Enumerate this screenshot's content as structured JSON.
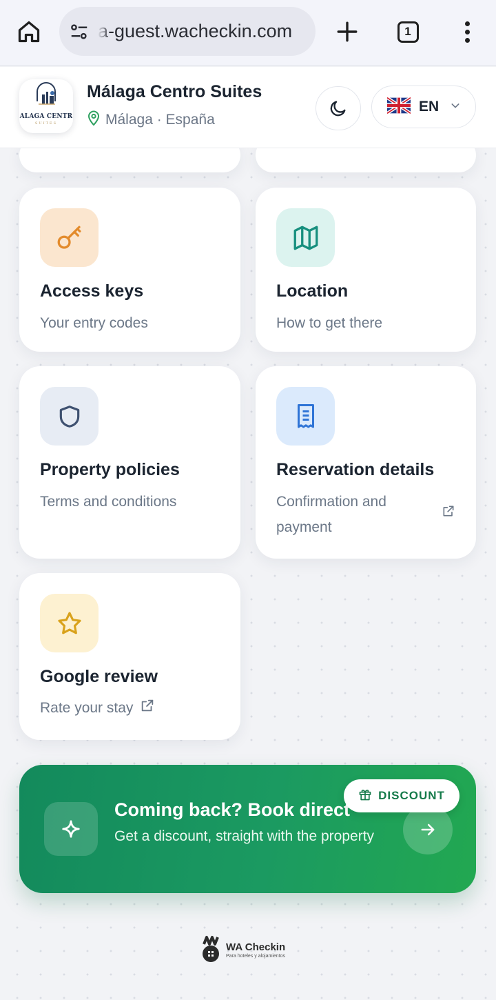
{
  "browser": {
    "url": "a-guest.wacheckin.com",
    "tab_count": "1"
  },
  "header": {
    "logo_text": "ALAGA CENTR",
    "logo_subtext": "SUITES",
    "property_name": "Málaga Centro Suites",
    "location": "Málaga · España",
    "language_code": "EN"
  },
  "cards": [
    {
      "title": "Access keys",
      "subtitle": "Your entry codes",
      "icon": "key-icon",
      "tile_color": "#fbe6cf",
      "icon_color": "#e38b2c"
    },
    {
      "title": "Location",
      "subtitle": "How to get there",
      "icon": "map-icon",
      "tile_color": "#dcf3ef",
      "icon_color": "#178f7e"
    },
    {
      "title": "Property policies",
      "subtitle": "Terms and conditions",
      "icon": "shield-icon",
      "tile_color": "#e7ecf4",
      "icon_color": "#3f5170"
    },
    {
      "title": "Reservation details",
      "subtitle": "Confirmation and payment",
      "icon": "receipt-icon",
      "tile_color": "#dbeafc",
      "icon_color": "#2f74d6"
    },
    {
      "title": "Google review",
      "subtitle": "Rate your stay",
      "icon": "star-icon",
      "tile_color": "#fdf1d1",
      "icon_color": "#d9a21b"
    }
  ],
  "promo": {
    "title": "Coming back? Book direct",
    "subtitle": "Get a discount, straight with the property",
    "badge": "DISCOUNT",
    "color": "#1b9a61"
  },
  "footer": {
    "brand_name": "WA Checkin",
    "brand_tagline": "Para hoteles y alojamientos"
  }
}
